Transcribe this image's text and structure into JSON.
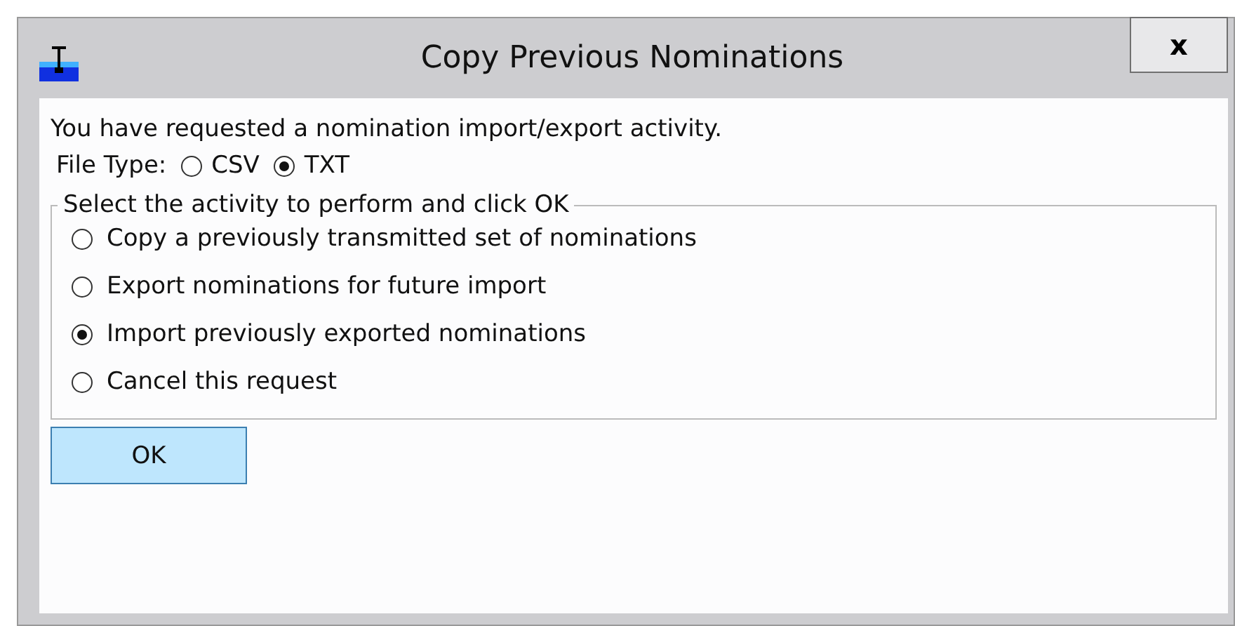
{
  "window": {
    "title": "Copy Previous Nominations",
    "close": "x"
  },
  "message": "You have requested a nomination import/export activity.",
  "file_type": {
    "label": "File Type:",
    "options": [
      {
        "label": "CSV",
        "selected": false
      },
      {
        "label": "TXT",
        "selected": true
      }
    ]
  },
  "activity": {
    "legend": "Select the activity to perform and click OK",
    "options": [
      {
        "label": "Copy a previously transmitted set of nominations",
        "selected": false
      },
      {
        "label": "Export nominations for future import",
        "selected": false
      },
      {
        "label": "Import previously exported nominations",
        "selected": true
      },
      {
        "label": "Cancel this request",
        "selected": false
      }
    ]
  },
  "buttons": [
    "OK"
  ]
}
